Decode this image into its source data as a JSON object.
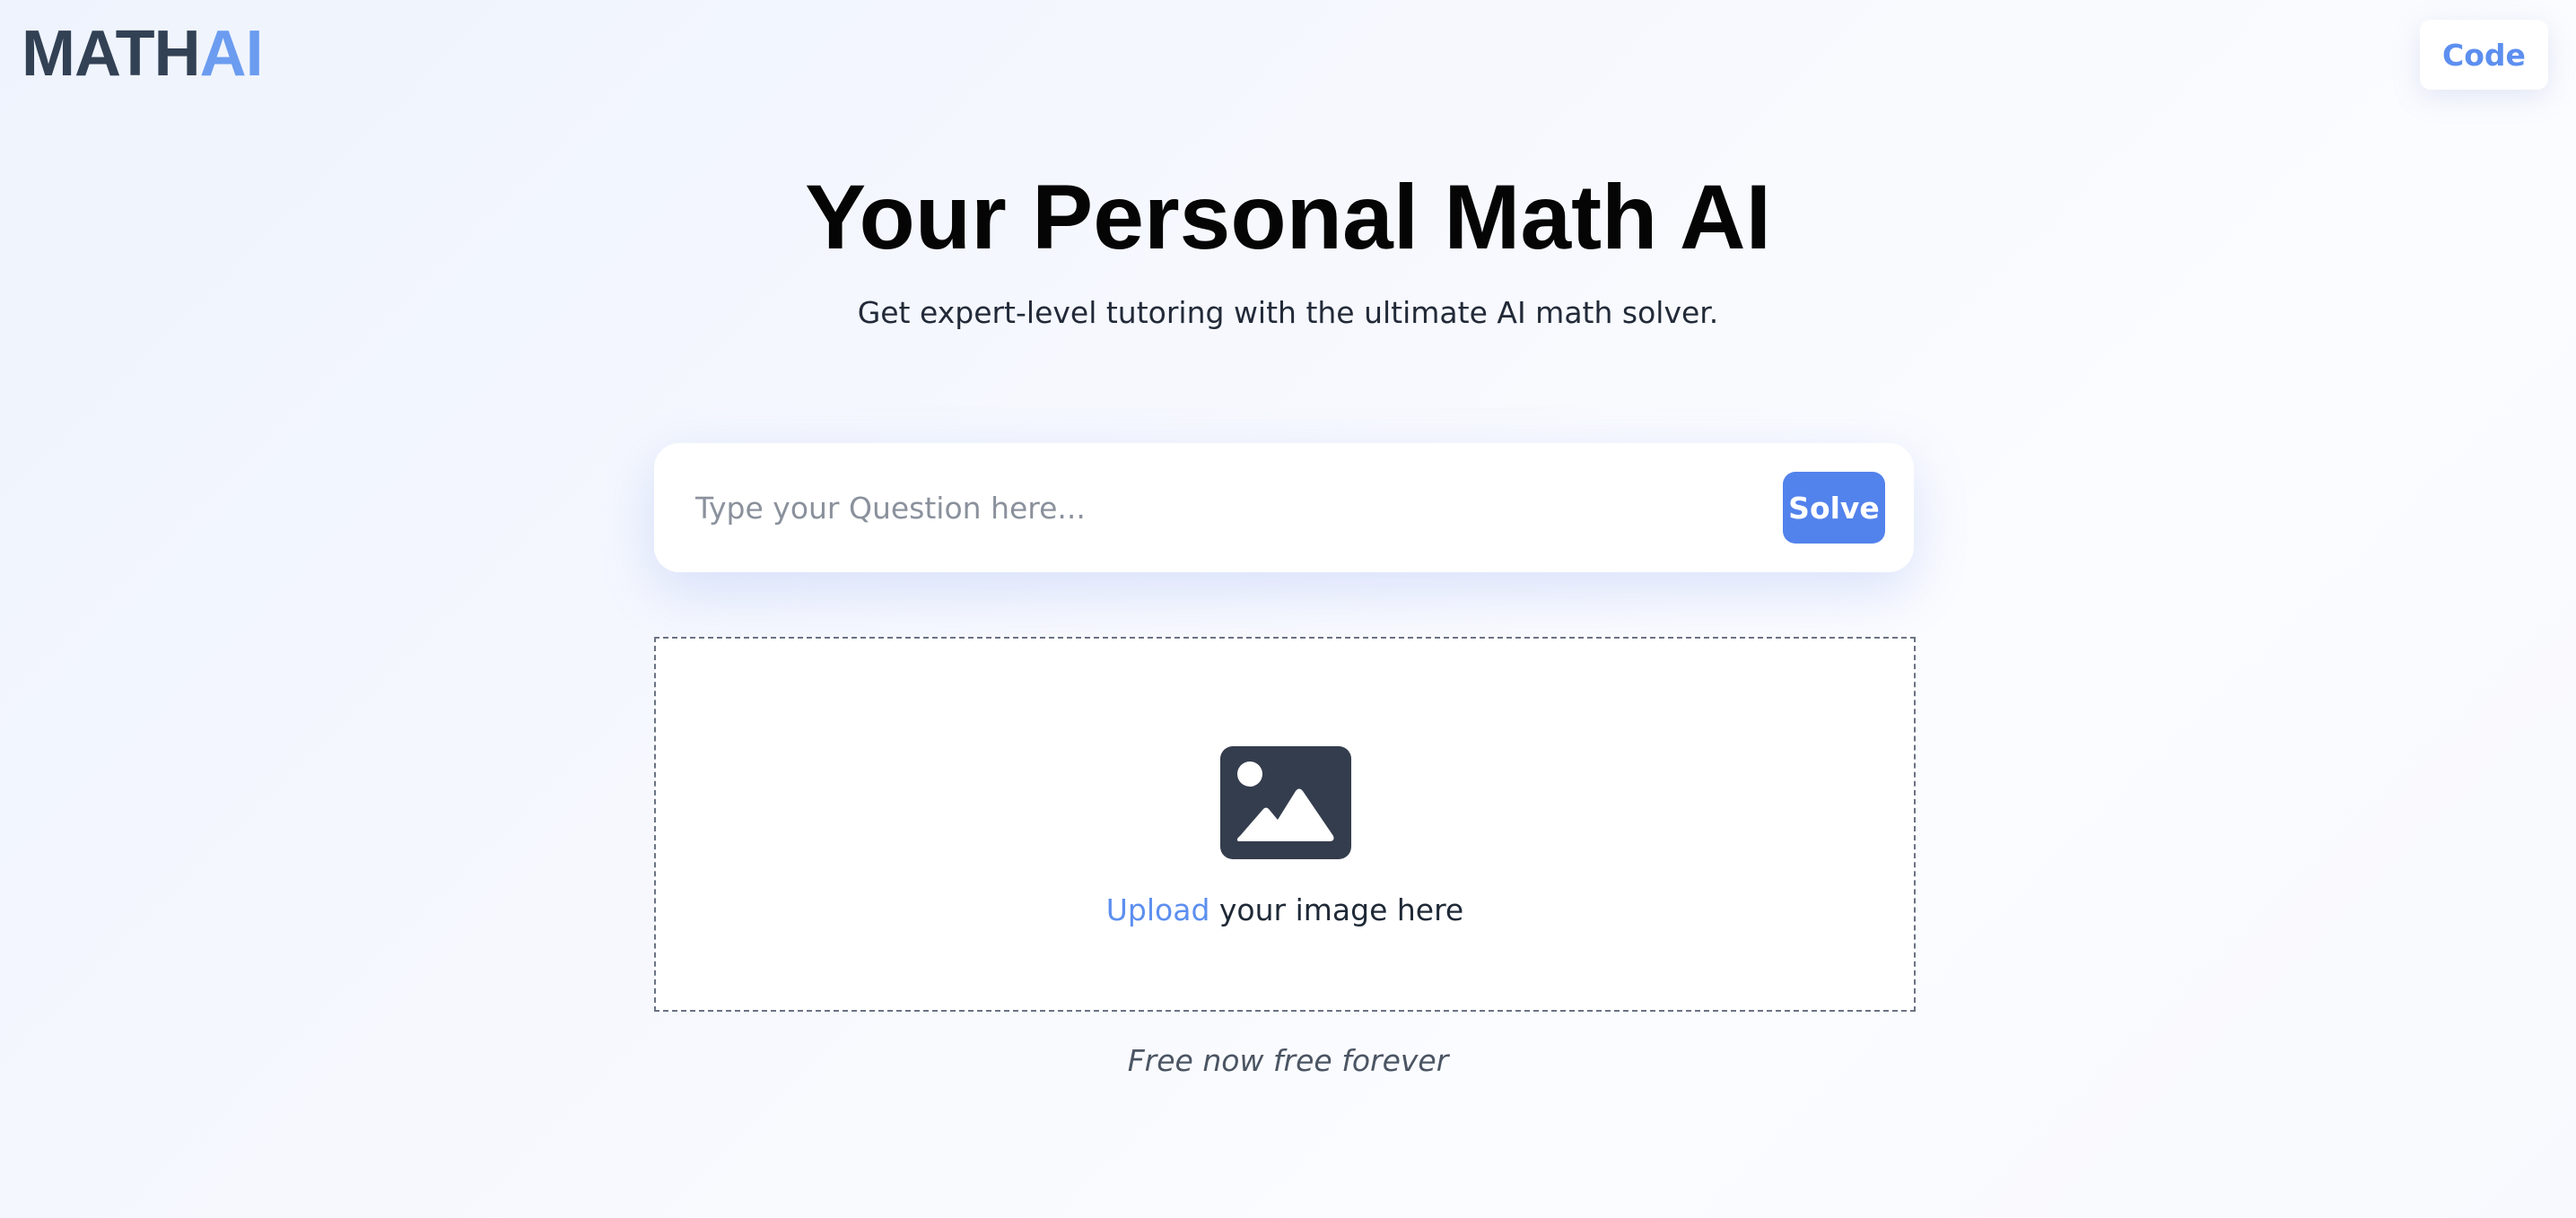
{
  "header": {
    "logo_main": "MATH",
    "logo_accent": "AI",
    "code_button_label": "Code"
  },
  "hero": {
    "title": "Your Personal Math AI",
    "subtitle": "Get expert-level tutoring with the ultimate AI math solver."
  },
  "search": {
    "placeholder": "Type your Question here...",
    "value": "",
    "solve_label": "Solve"
  },
  "upload": {
    "icon": "image-icon",
    "link_text": "Upload",
    "rest_text": " your image here"
  },
  "footer": {
    "note": "Free now free forever"
  },
  "colors": {
    "accent": "#5d8ff0",
    "solve_button": "#5282ec",
    "logo_dark": "#334155",
    "icon_dark": "#343d4d"
  }
}
